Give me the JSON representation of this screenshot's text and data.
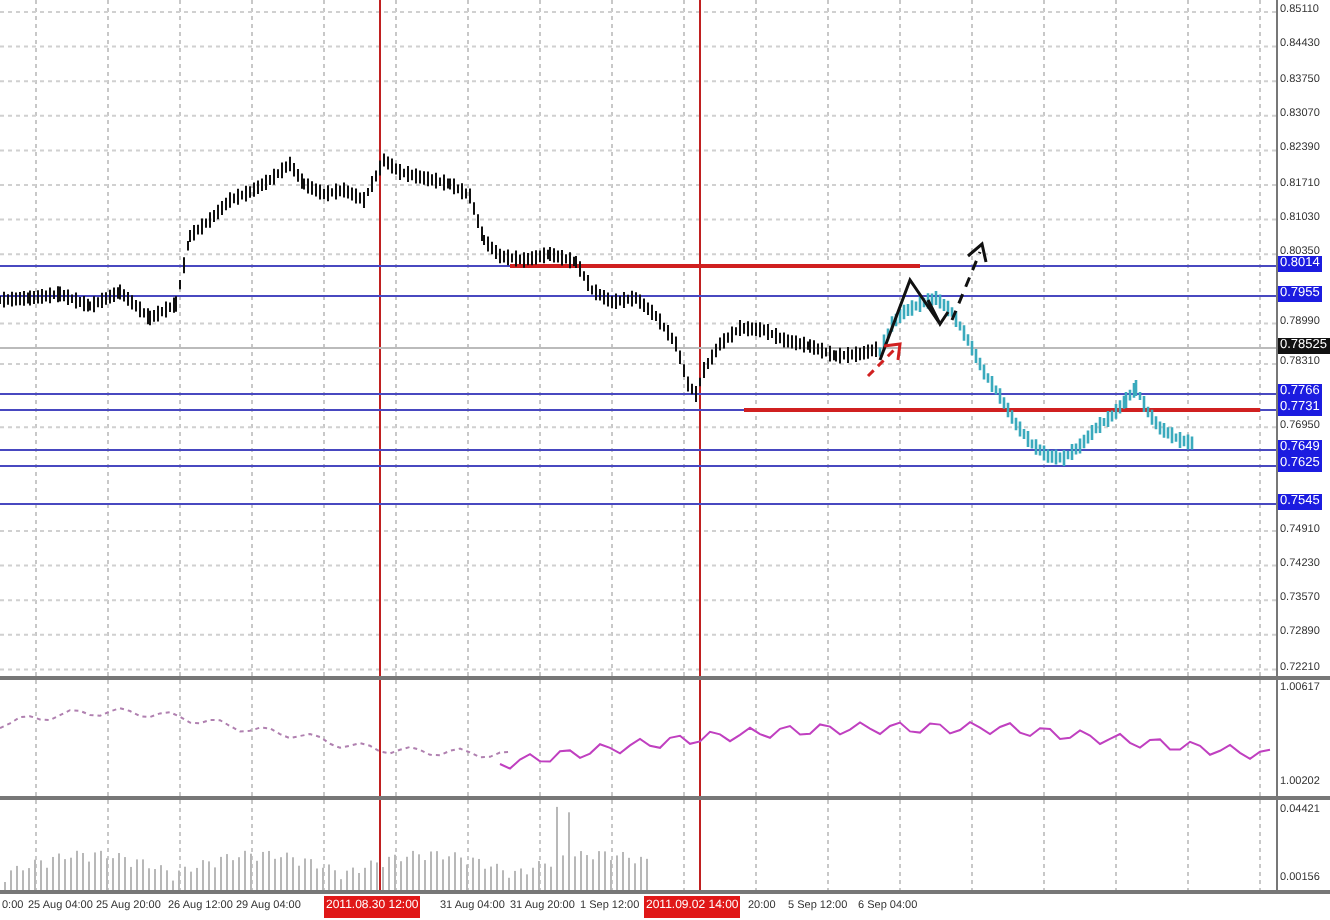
{
  "price_axis": {
    "ticks": [
      "0.85110",
      "0.84430",
      "0.83750",
      "0.83070",
      "0.82390",
      "0.81710",
      "0.81030",
      "0.80350",
      "0.78990",
      "0.78310",
      "0.76950",
      "0.74910",
      "0.74230",
      "0.73570",
      "0.72890",
      "0.72210"
    ],
    "level_tags": [
      {
        "label": "0.8014",
        "kind": "level"
      },
      {
        "label": "0.7955",
        "kind": "level"
      },
      {
        "label": "0.78525",
        "kind": "current"
      },
      {
        "label": "0.7766",
        "kind": "level"
      },
      {
        "label": "0.7731",
        "kind": "level"
      },
      {
        "label": "0.7649",
        "kind": "level"
      },
      {
        "label": "0.7625",
        "kind": "level"
      },
      {
        "label": "0.7545",
        "kind": "level"
      }
    ]
  },
  "indicator_axis": [
    "1.00617",
    "1.00202"
  ],
  "volume_axis": [
    "0.04421",
    "0.00156"
  ],
  "time_axis": [
    {
      "label": "0:00",
      "kind": "tick"
    },
    {
      "label": "25 Aug 04:00",
      "kind": "tick"
    },
    {
      "label": "25 Aug 20:00",
      "kind": "tick"
    },
    {
      "label": "26 Aug 12:00",
      "kind": "tick"
    },
    {
      "label": "29 Aug 04:00",
      "kind": "tick"
    },
    {
      "label": "2011.08.30 12:00",
      "kind": "marker"
    },
    {
      "label": "31 Aug 04:00",
      "kind": "tick"
    },
    {
      "label": "31 Aug 20:00",
      "kind": "tick"
    },
    {
      "label": "1 Sep 12:00",
      "kind": "tick"
    },
    {
      "label": "2011.09.02 14:00",
      "kind": "marker"
    },
    {
      "label": "20:00",
      "kind": "tick"
    },
    {
      "label": "5 Sep 12:00",
      "kind": "tick"
    },
    {
      "label": "6 Sep 04:00",
      "kind": "tick"
    }
  ]
}
